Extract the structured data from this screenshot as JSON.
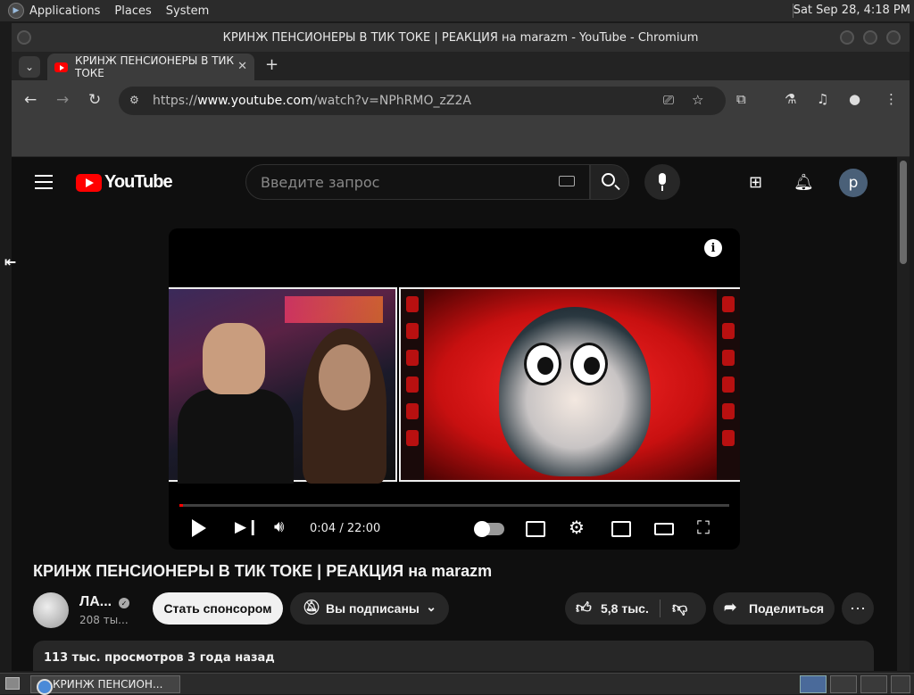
{
  "desktop": {
    "menus": [
      "Applications",
      "Places",
      "System"
    ],
    "clock": "Sat Sep 28,  4:18 PM"
  },
  "window": {
    "title": "КРИНЖ ПЕНСИОНЕРЫ В ТИК ТОКЕ | РЕАКЦИЯ на marazm - YouTube - Chromium"
  },
  "browser": {
    "tab_title": "КРИНЖ ПЕНСИОНЕРЫ В ТИК ТОКЕ",
    "url_prefix": "https://",
    "url_host": "www.youtube.com",
    "url_path": "/watch?v=NPhRMO_zZ2A"
  },
  "youtube": {
    "logo_text": "YouTube",
    "search_placeholder": "Введите запрос",
    "avatar_letter": "p",
    "player": {
      "current_time": "0:04",
      "duration": "22:00",
      "time_display": "0:04 / 22:00",
      "progress_fraction": 0.003
    },
    "video_title": "КРИНЖ ПЕНСИОНЕРЫ В ТИК ТОКЕ | РЕАКЦИЯ на marazm",
    "channel": {
      "name": "ЛА...",
      "subscribers": "208 ты..."
    },
    "buttons": {
      "sponsor": "Стать спонсором",
      "subscribed": "Вы подписаны",
      "likes": "5,8 тыс.",
      "share": "Поделиться"
    },
    "description_line": "113 тыс. просмотров  3 года назад"
  },
  "taskbar": {
    "task_label": "КРИНЖ ПЕНСИОН..."
  }
}
